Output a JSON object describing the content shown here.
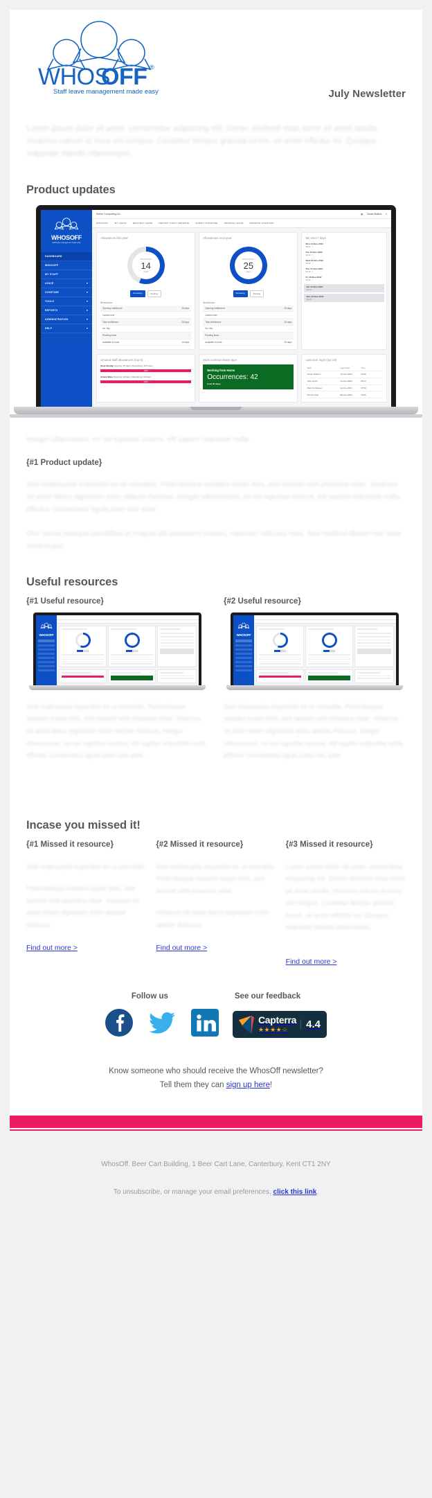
{
  "brand": {
    "logo_wordmark_light": "WHOS",
    "logo_wordmark_bold": "OFF",
    "logo_registered": "®",
    "tagline": "Staff leave management made easy",
    "accent_blue": "#0d4fc4",
    "accent_pink": "#ec1b63",
    "text_gray": "#58585a"
  },
  "header": {
    "newsletter_title": "July Newsletter"
  },
  "intro": {
    "paragraph": "Lorem ipsum dolor sit amet, consectetur adipiscing elit. Donec eleifend vitae tortor sit amet iaculis. Vivamus rutrum id risus vel congue. Curabitur tempor gravida lorem, sit amet efficitur mi. Quisque vulputate blandit ullamcorper."
  },
  "product_updates": {
    "heading": "Product updates",
    "caption": "Integer ullamcorper, mi vel egestas viverra, elit sapien vulputate nulla.",
    "update_title": "{#1 Product update}",
    "body_1": "Sed malesuada imperdiet ex ut convallis. Pellentesque sodales turpis felis, sed laoreet velit pharetra vitae. Vivamus sit amet libero dignissim enim aliquet rhoncus. Integer ullamcorper, mi vel egestas viverra, elit sapien vulputate nulla, efficitur consectetur ligula justo nec ante.",
    "body_2": "Orci varius natoque penatibus et magnis dis parturient montes, nascetur ridiculus mus. Sed eleifend dictum nisi vitae scelerisque."
  },
  "useful_resources": {
    "heading": "Useful resources",
    "items": [
      {
        "title": "{#1 Useful resource}",
        "body": "Sed malesuada imperdiet ex ut convallis. Pellentesque sodales turpis felis, sed laoreet velit pharetra vitae. Vivamus sit amet libero dignissim enim aliquet rhoncus, integer ullamcorper, mi vel egestas viverra, elit sapien vulputate nulla, efficitur consectetur ligula justo nec ante."
      },
      {
        "title": "{#2 Useful resource}",
        "body": "Sed malesuada imperdiet ex ut convallis. Pellentesque sodales turpis felis, sed laoreet velit pharetra vitae. Vivamus sit amet libero dignissim enim aliquet rhoncus, integer ullamcorper, mi vel egestas viverra, elit sapien vulputate nulla, efficitur consectetur ligula justo nec ante."
      }
    ]
  },
  "missed_it": {
    "heading": "Incase you missed it!",
    "items": [
      {
        "title": "{#1 Missed it resource}",
        "body_1": "Sed malesuada imperdiet ex ut convallis.",
        "body_2": "Pellentesque sodales turpis felis, sed laoreet velit pharetra vitae. Vivamus sit amet libero dignissim enim aliquet rhoncus.",
        "link": "Find out more >"
      },
      {
        "title": "{#2 Missed it resource}",
        "body_1": "Sed malesuada imperdiet ex ut convallis. Pellentesque sodales turpis felis, sed laoreet velit pharetra vitae.",
        "body_2": "Vivamus sit amet libero dignissim enim aliquet rhoncus.",
        "link": "Find out more >"
      },
      {
        "title": "{#3 Missed it resource}",
        "body_1": "Lorem ipsum dolor sit amet, consectetur adipiscing elit. Donec eleifend vitae tortor sit amet iaculis. Vivamus rutrum id risus vel congue. Curabitur tempor gravida lorem, sit amet efficitur mi. Quisque vulputate blandit ullamcorper.",
        "body_2": "",
        "link": "Find out more >"
      }
    ]
  },
  "social": {
    "follow_label": "Follow us",
    "feedback_label": "See our feedback",
    "icons": [
      "facebook-icon",
      "twitter-icon",
      "linkedin-icon"
    ],
    "capterra": {
      "name": "Capterra",
      "stars": "★★★★",
      "half_star": "½",
      "score": "4.4"
    }
  },
  "refer": {
    "line_1": "Know someone who should receive the WhosOff newsletter?",
    "line_2_prefix": "Tell them they can ",
    "line_2_link": "sign up here",
    "line_2_suffix": "!"
  },
  "footer": {
    "address": "WhosOff. Beer Cart Building, 1 Beer Cart Lane, Canterbury, Kent CT1 2NY",
    "unsubscribe_prefix": "To unsubscribe, or manage your email preferences, ",
    "unsubscribe_link": "click this link",
    "unsubscribe_suffix": "."
  },
  "dashboard": {
    "company": "Kdrive Computing Ltd",
    "user": "Susan Watkins",
    "logo_light": "WHOS",
    "logo_bold": "OFF",
    "logo_sub": "Staff leave management made easy",
    "nav": [
      {
        "label": "DASHBOARD",
        "caret": ""
      },
      {
        "label": "WHOSOFF",
        "caret": ""
      },
      {
        "label": "MY STAFF",
        "caret": ""
      },
      {
        "label": "LEAVE",
        "caret": "▾"
      },
      {
        "label": "OVERTIME",
        "caret": "▾"
      },
      {
        "label": "TOOLS",
        "caret": "▾"
      },
      {
        "label": "REPORTS",
        "caret": "▾"
      },
      {
        "label": "ADMINISTRATION",
        "caret": "▾"
      },
      {
        "label": "HELP",
        "caret": "▾"
      }
    ],
    "tabs": [
      "WHOSOFF",
      "MY LEAVE",
      "REQUEST LEAVE",
      "REPORT STAFF ABSENCE",
      "SUBMIT OVERTIME",
      "PENDING LEAVE",
      "PENDING OVERTIME"
    ],
    "cards": {
      "allowances_this_year": {
        "title": "Allowances this year",
        "donut_label": "REMAINING",
        "donut_value": "14",
        "donut_unit": "(days)",
        "donut_percent": 56,
        "pill_primary": "Remaining",
        "pill_secondary": "Pending",
        "breakdown_label": "Breakdown:",
        "rows": [
          {
            "label": "Opening entitlement",
            "value": "25 days"
          },
          {
            "label": "Carried over",
            "value": "-"
          },
          {
            "label": "Total entitlement",
            "value": "25 days"
          },
          {
            "label": "inc. bky",
            "value": "-"
          },
          {
            "label": "Pending leave",
            "value": "-"
          },
          {
            "label": "Available to book",
            "value": "14 days"
          }
        ]
      },
      "allowances_next_year": {
        "title": "Allowances next year",
        "donut_label": "REMAINING",
        "donut_value": "25",
        "donut_unit": "(days)",
        "donut_percent": 100,
        "pill_primary": "Remaining",
        "pill_secondary": "Pending",
        "breakdown_label": "Breakdown:",
        "rows": [
          {
            "label": "Opening entitlement",
            "value": "25 days"
          },
          {
            "label": "Carried over",
            "value": "-"
          },
          {
            "label": "Total entitlement",
            "value": "25 days"
          },
          {
            "label": "inc. bky",
            "value": "-"
          },
          {
            "label": "Pending leave",
            "value": "-"
          },
          {
            "label": "Available to book",
            "value": "25 days"
          }
        ]
      },
      "next_7_days": {
        "title": "My next 7 days",
        "days": [
          {
            "date": "Mon 14-Nov-2022",
            "work": "Work: ✓",
            "shaded": false
          },
          {
            "date": "Tue 15-Nov-2022",
            "work": "Work: ✓",
            "shaded": false
          },
          {
            "date": "Wed 16-Nov-2022",
            "work": "Work: ✓",
            "shaded": false
          },
          {
            "date": "Thu 17-Nov-2022",
            "work": "Work: ✓",
            "shaded": false
          },
          {
            "date": "Fri 18-Nov-2022",
            "work": "Work: ✓",
            "shaded": false
          },
          {
            "date": "Sat 19-Nov-2022",
            "work": "Work: -",
            "shaded": true
          },
          {
            "date": "Sun 20-Nov-2022",
            "work": "Work: -",
            "shaded": true
          }
        ]
      },
      "unused_allowances": {
        "title": "Unused staff allowances (top 5)",
        "items": [
          {
            "name": "Knut Abodaj",
            "detail": "Opening: 25 days | Remaining: 26.5 days",
            "bar_label": "100%",
            "bar_percent": 100
          },
          {
            "name": "Ariana Ware",
            "detail": "Opening: 10 days | Remaining: 10 days",
            "bar_label": "100%",
            "bar_percent": 100
          }
        ]
      },
      "common_leave_type": {
        "title": "Most common leave type",
        "type_name": "Working from Home",
        "occurrences": "Occurrences: 42",
        "period": "(Last 30 days)"
      },
      "last_login": {
        "title": "Last user login (top 10)",
        "columns": [
          "Staff",
          "Login date",
          "Time"
        ],
        "rows": [
          [
            "Susan Watkins",
            "14-Nov-2022",
            "10:05"
          ],
          [
            "John Smith",
            "14-Nov-2022",
            "09:44"
          ],
          [
            "Mark Tomkinson",
            "11-Nov-2022",
            "15:50"
          ],
          [
            "Phil d'Cossa",
            "08-Nov-2022",
            "15:05"
          ]
        ]
      }
    }
  }
}
